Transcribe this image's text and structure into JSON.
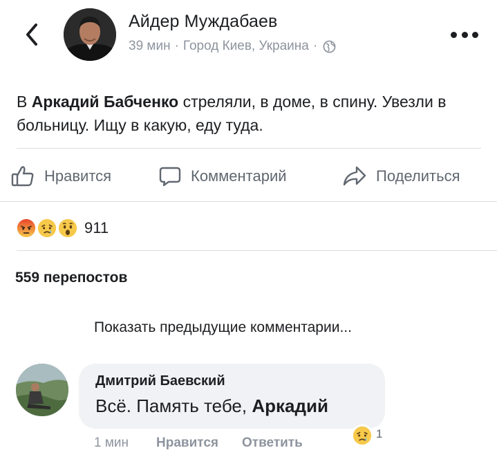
{
  "header": {
    "author": "Айдер Муждабаев",
    "time": "39 мин",
    "separator": "·",
    "location": "Город Киев, Украина",
    "separator2": "·",
    "audience_icon": "globe-icon"
  },
  "post": {
    "prefix": "В ",
    "mention": "Аркадий Бабченко",
    "rest": " стреляли, в доме, в спину. Увезли в больницу. Ищу в какую, еду туда."
  },
  "actions": {
    "like": "Нравится",
    "comment": "Комментарий",
    "share": "Поделиться"
  },
  "reactions": {
    "icons": [
      "angry-reaction-icon",
      "sad-reaction-icon",
      "wow-reaction-icon"
    ],
    "count": "911"
  },
  "shares": "559 перепостов",
  "prev_comments": "Показать предыдущие комментарии...",
  "comment": {
    "name": "Дмитрий Баевский",
    "text": "Всё. Память тебе, ",
    "mention": "Аркадий",
    "time": "1 мин",
    "like": "Нравится",
    "reply": "Ответить",
    "reaction_icon": "sad-reaction-icon",
    "reaction_count": "1"
  },
  "colors": {
    "text": "#1c1e21",
    "secondary": "#8d949e",
    "action": "#606770",
    "divider": "#dadde1",
    "bubble": "#f0f2f5",
    "angry": "#f0553c",
    "yellow": "#f7c94b"
  }
}
